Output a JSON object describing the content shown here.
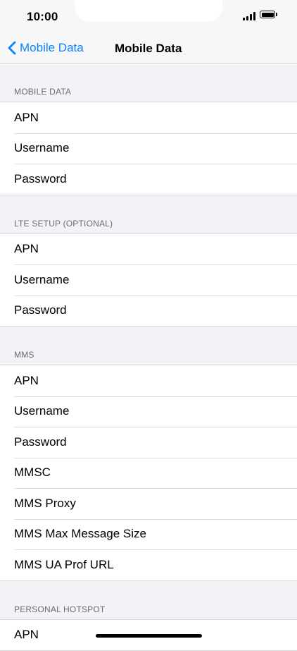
{
  "status_bar": {
    "time": "10:00"
  },
  "nav": {
    "back_label": "Mobile Data",
    "title": "Mobile Data"
  },
  "sections": [
    {
      "header": "MOBILE DATA",
      "rows": [
        "APN",
        "Username",
        "Password"
      ]
    },
    {
      "header": "LTE SETUP (OPTIONAL)",
      "rows": [
        "APN",
        "Username",
        "Password"
      ]
    },
    {
      "header": "MMS",
      "rows": [
        "APN",
        "Username",
        "Password",
        "MMSC",
        "MMS Proxy",
        "MMS Max Message Size",
        "MMS UA Prof URL"
      ]
    },
    {
      "header": "PERSONAL HOTSPOT",
      "rows": [
        "APN"
      ]
    }
  ],
  "colors": {
    "accent": "#0a84ff",
    "background": "#f2f2f7"
  },
  "icons": {
    "back": "chevron-left-icon",
    "signal": "cellular-signal-icon",
    "battery": "battery-icon"
  }
}
